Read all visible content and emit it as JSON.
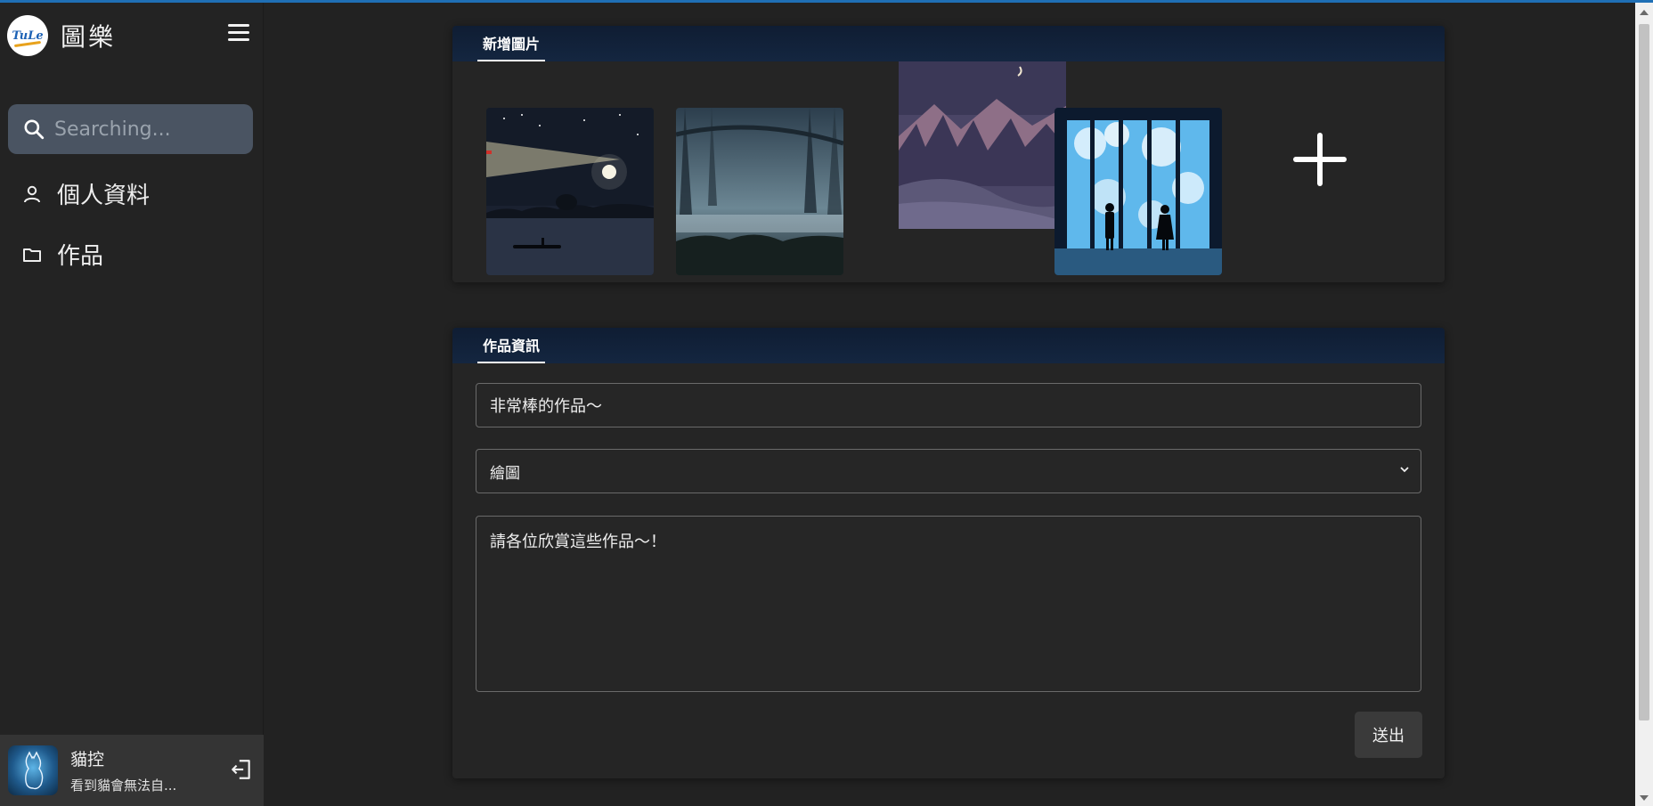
{
  "app": {
    "name": "圖樂",
    "logo_text": "TuLe"
  },
  "search": {
    "placeholder": "Searching..."
  },
  "nav": {
    "items": [
      {
        "label": "個人資料",
        "icon": "user-icon"
      },
      {
        "label": "作品",
        "icon": "folder-icon"
      }
    ]
  },
  "user": {
    "name": "貓控",
    "status": "看到貓會無法自..."
  },
  "images_section": {
    "tab_label": "新增圖片",
    "images": [
      {
        "name": "night-lake-boat-image"
      },
      {
        "name": "misty-forest-swamp-image"
      },
      {
        "name": "purple-mountains-image"
      },
      {
        "name": "couple-window-sky-image"
      }
    ]
  },
  "info_section": {
    "tab_label": "作品資訊",
    "title_value": "非常棒的作品～",
    "category_value": "繪圖",
    "description_value": "請各位欣賞這些作品～！",
    "submit_label": "送出"
  },
  "colors": {
    "background": "#222222",
    "sidebar": "#232323",
    "card_header": "#142640",
    "search_bg": "#4a5462"
  }
}
